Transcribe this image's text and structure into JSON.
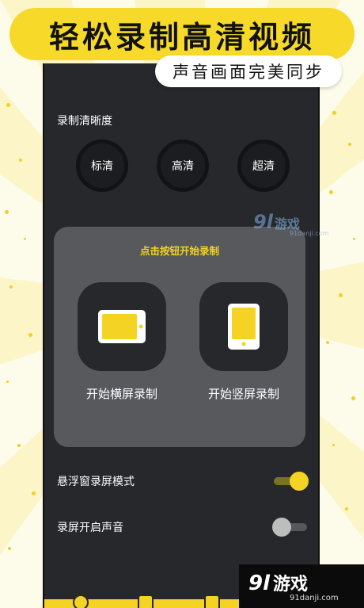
{
  "header": {
    "title": "轻松录制高清视频",
    "subtitle": "声音画面完美同步"
  },
  "quality": {
    "label": "录制清晰度",
    "options": [
      "标清",
      "高清",
      "超清"
    ]
  },
  "watermark_top": {
    "logo": "9l",
    "text": "游戏",
    "url": "91danji.com"
  },
  "record_card": {
    "hint": "点击按钮开始录制",
    "landscape_label": "开始横屏录制",
    "portrait_label": "开始竖屏录制",
    "accent_color": "#f4d324"
  },
  "settings": {
    "floating_window": {
      "label": "悬浮窗录屏模式",
      "on": true
    },
    "record_audio": {
      "label": "录屏开启声音",
      "on": false
    }
  },
  "watermark_bottom": {
    "logo": "9l",
    "text": "游戏",
    "url": "91danji.com"
  },
  "colors": {
    "brand_yellow": "#f4d324",
    "panel_dark": "#26282c",
    "card_gray": "#57595c"
  },
  "icons": [
    "tablet-landscape-icon",
    "phone-portrait-icon",
    "nav-home-icon",
    "nav-video-icon",
    "nav-settings-icon"
  ]
}
